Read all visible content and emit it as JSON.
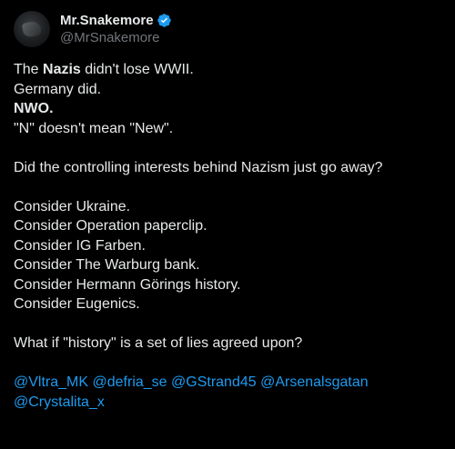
{
  "author": {
    "display_name": "Mr.Snakemore",
    "handle": "@MrSnakemore",
    "verified_icon": "verified-badge-icon",
    "avatar_icon": "avatar"
  },
  "colors": {
    "background": "#000000",
    "text": "#e7e9ea",
    "secondary": "#71767b",
    "link": "#1d9bf0"
  },
  "tweet": {
    "line1_pre": "The ",
    "line1_bold": "Nazis",
    "line1_post": " didn't lose WWII.",
    "line2": "Germany did.",
    "line3": "NWO.",
    "line4": "\"N\" doesn't mean \"New\".",
    "question": "Did the controlling interests behind Nazism just go away?",
    "consider": [
      "Consider Ukraine.",
      "Consider Operation paperclip.",
      "Consider IG Farben.",
      "Consider The Warburg bank.",
      "Consider Hermann Görings history.",
      "Consider Eugenics."
    ],
    "closing": "What if \"history\" is a set of lies agreed upon?",
    "mentions": [
      "@Vltra_MK",
      "@defria_se",
      "@GStrand45",
      "@Arsenalsgatan",
      "@Crystalita_x"
    ]
  }
}
